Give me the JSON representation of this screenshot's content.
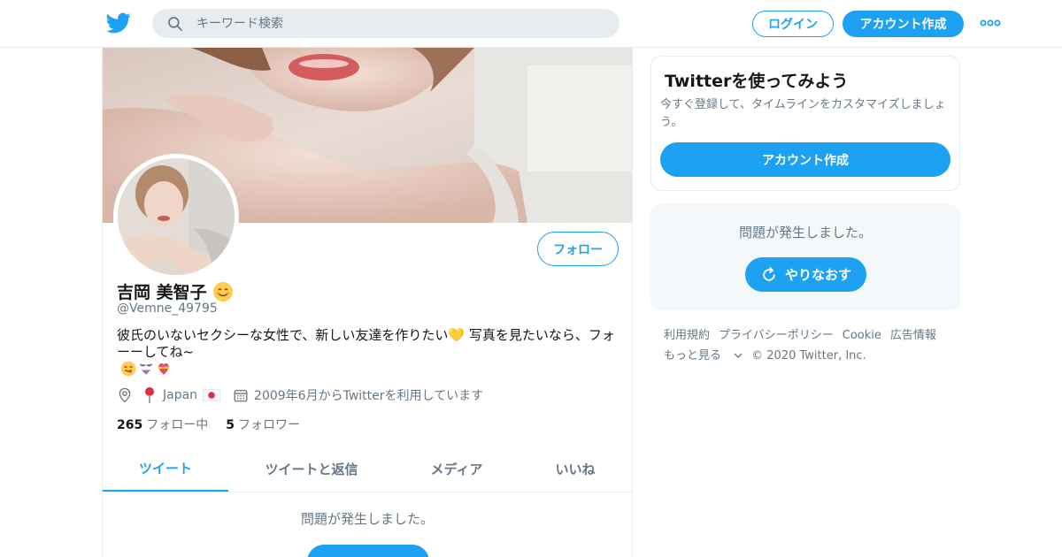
{
  "topbar": {
    "search_placeholder": "キーワード検索",
    "login_label": "ログイン",
    "signup_label": "アカウント作成"
  },
  "profile": {
    "display_name": "吉岡 美智子",
    "handle": "@Vemne_49795",
    "follow_label": "フォロー",
    "bio_text": "彼氏のいないセクシーな女性で、新しい友達を作りたい💛 写真を見たいなら、フォーーしてね~",
    "location": "Japan",
    "joined": "2009年6月からTwitterを利用しています",
    "following_count": "265",
    "following_label": "フォロー中",
    "followers_count": "5",
    "followers_label": "フォロワー"
  },
  "tabs": [
    {
      "label": "ツイート",
      "active": true
    },
    {
      "label": "ツイートと返信",
      "active": false
    },
    {
      "label": "メディア",
      "active": false
    },
    {
      "label": "いいね",
      "active": false
    }
  ],
  "timeline": {
    "error_text": "問題が発生しました。"
  },
  "sidebar": {
    "signup_card": {
      "title": "Twitterを使ってみよう",
      "description": "今すぐ登録して、タイムラインをカスタマイズしましょう。",
      "button_label": "アカウント作成"
    },
    "error_card": {
      "error_text": "問題が発生しました。",
      "retry_label": "やりなおす"
    },
    "footer": {
      "links": [
        "利用規約",
        "プライバシーポリシー",
        "Cookie",
        "広告情報"
      ],
      "more_label": "もっと見る",
      "copyright": "© 2020 Twitter, Inc."
    }
  },
  "colors": {
    "accent": "#1da1f2",
    "text_primary": "#14171a",
    "text_secondary": "#657786",
    "border": "#e6ecf0"
  },
  "icons": [
    "twitter-bird-icon",
    "search-icon",
    "more-dots-icon",
    "location-icon",
    "pin-emoji-icon",
    "japan-flag-icon",
    "calendar-icon",
    "smile-emoji-icon",
    "yellow-heart-emoji-icon",
    "refresh-icon",
    "chevron-down-icon"
  ]
}
